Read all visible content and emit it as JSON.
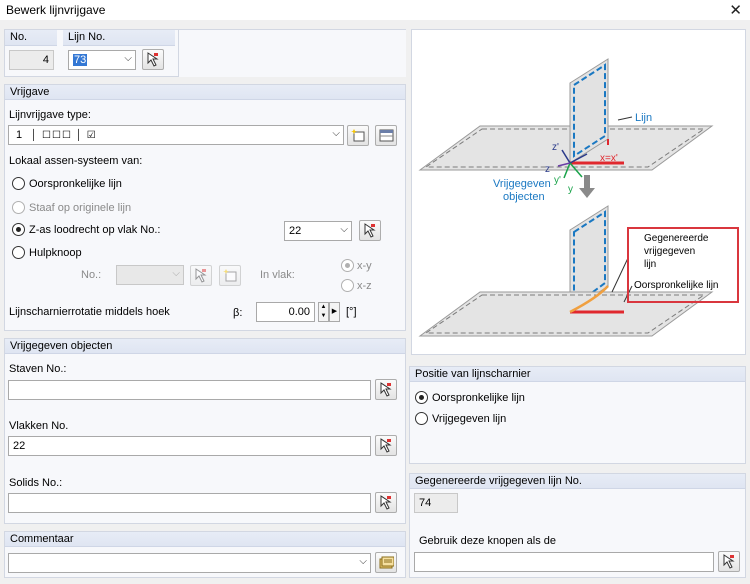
{
  "window": {
    "title": "Bewerk lijnvrijgave",
    "close_glyph": "✕"
  },
  "top": {
    "no_label": "No.",
    "no_value": "4",
    "line_label": "Lijn No.",
    "line_value": "73"
  },
  "release": {
    "header": "Vrijgave",
    "type_label": "Lijnvrijgave type:",
    "type_value": "1",
    "axis_label": "Lokaal assen-systeem van:",
    "options": [
      "Oorspronkelijke lijn",
      "Staaf op originele lijn",
      "Z-as loodrecht op vlak No.:",
      "Hulpknoop"
    ],
    "selected_option": 2,
    "surface_value": "22",
    "node_label": "No.:",
    "in_plane_label": "In vlak:",
    "plane_options": [
      "x-y",
      "x-z"
    ],
    "rotation_label": "Lijnscharnierrotatie middels hoek",
    "beta_label": "β:",
    "beta_value": "0.00",
    "unit": "[°]"
  },
  "released_objects": {
    "header": "Vrijgegeven objecten",
    "members_label": "Staven No.:",
    "members_value": "",
    "surfaces_label": "Vlakken No.",
    "surfaces_value": "22",
    "solids_label": "Solids No.:",
    "solids_value": ""
  },
  "comment": {
    "header": "Commentaar",
    "value": ""
  },
  "diagram": {
    "line": "Lijn",
    "released_objects": [
      "Vrijgegeven",
      "objecten"
    ],
    "generated": [
      "Gegenereerde",
      "vrijgegeven",
      "lijn"
    ],
    "original": "Oorspronkelijke lijn",
    "axes": {
      "x": "x=x'",
      "y": "y",
      "y_prime": "y'",
      "z": "z",
      "z_prime": "z'"
    },
    "colors": {
      "line": "#e0282e",
      "frame": "#d9363e",
      "blue": "#1a78c2",
      "orange": "#f0a040"
    }
  },
  "position": {
    "header": "Positie van lijnscharnier",
    "options": [
      "Oorspronkelijke lijn",
      "Vrijgegeven lijn"
    ],
    "selected": 0
  },
  "generated": {
    "header": "Gegenereerde vrijgegeven lijn No.",
    "value": "74",
    "use_label": "Gebruik deze knopen als de",
    "use_value": ""
  }
}
